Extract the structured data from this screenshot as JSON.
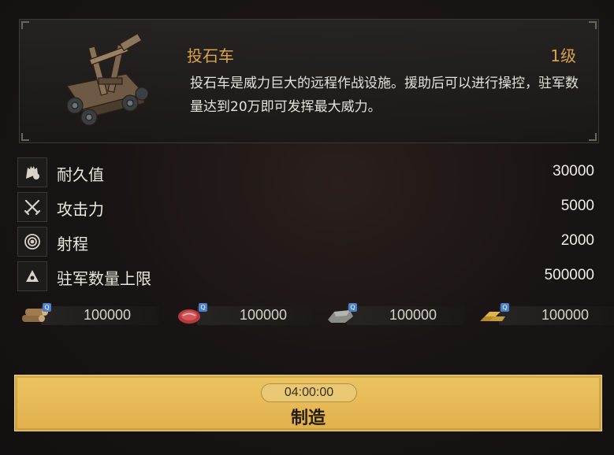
{
  "unit": {
    "name": "投石车",
    "level": "1级",
    "description": "投石车是威力巨大的远程作战设施。援助后可以进行操控，驻军数量达到20万即可发挥最大威力。",
    "icon": "catapult-icon"
  },
  "stats": [
    {
      "icon": "durability-icon",
      "label": "耐久值",
      "value": "30000"
    },
    {
      "icon": "crossed-swords-icon",
      "label": "攻击力",
      "value": "5000"
    },
    {
      "icon": "target-icon",
      "label": "射程",
      "value": "2000"
    },
    {
      "icon": "garrison-icon",
      "label": "驻军数量上限",
      "value": "500000"
    }
  ],
  "resources": [
    {
      "icon": "wood-icon",
      "amount": "100000"
    },
    {
      "icon": "food-meat-icon",
      "amount": "100000"
    },
    {
      "icon": "stone-icon",
      "amount": "100000"
    },
    {
      "icon": "gold-bars-icon",
      "amount": "100000"
    }
  ],
  "build": {
    "time": "04:00:00",
    "label": "制造"
  },
  "colors": {
    "accent": "#d9a24b",
    "button": "#e6b855",
    "badge": "#4a7fd0"
  }
}
